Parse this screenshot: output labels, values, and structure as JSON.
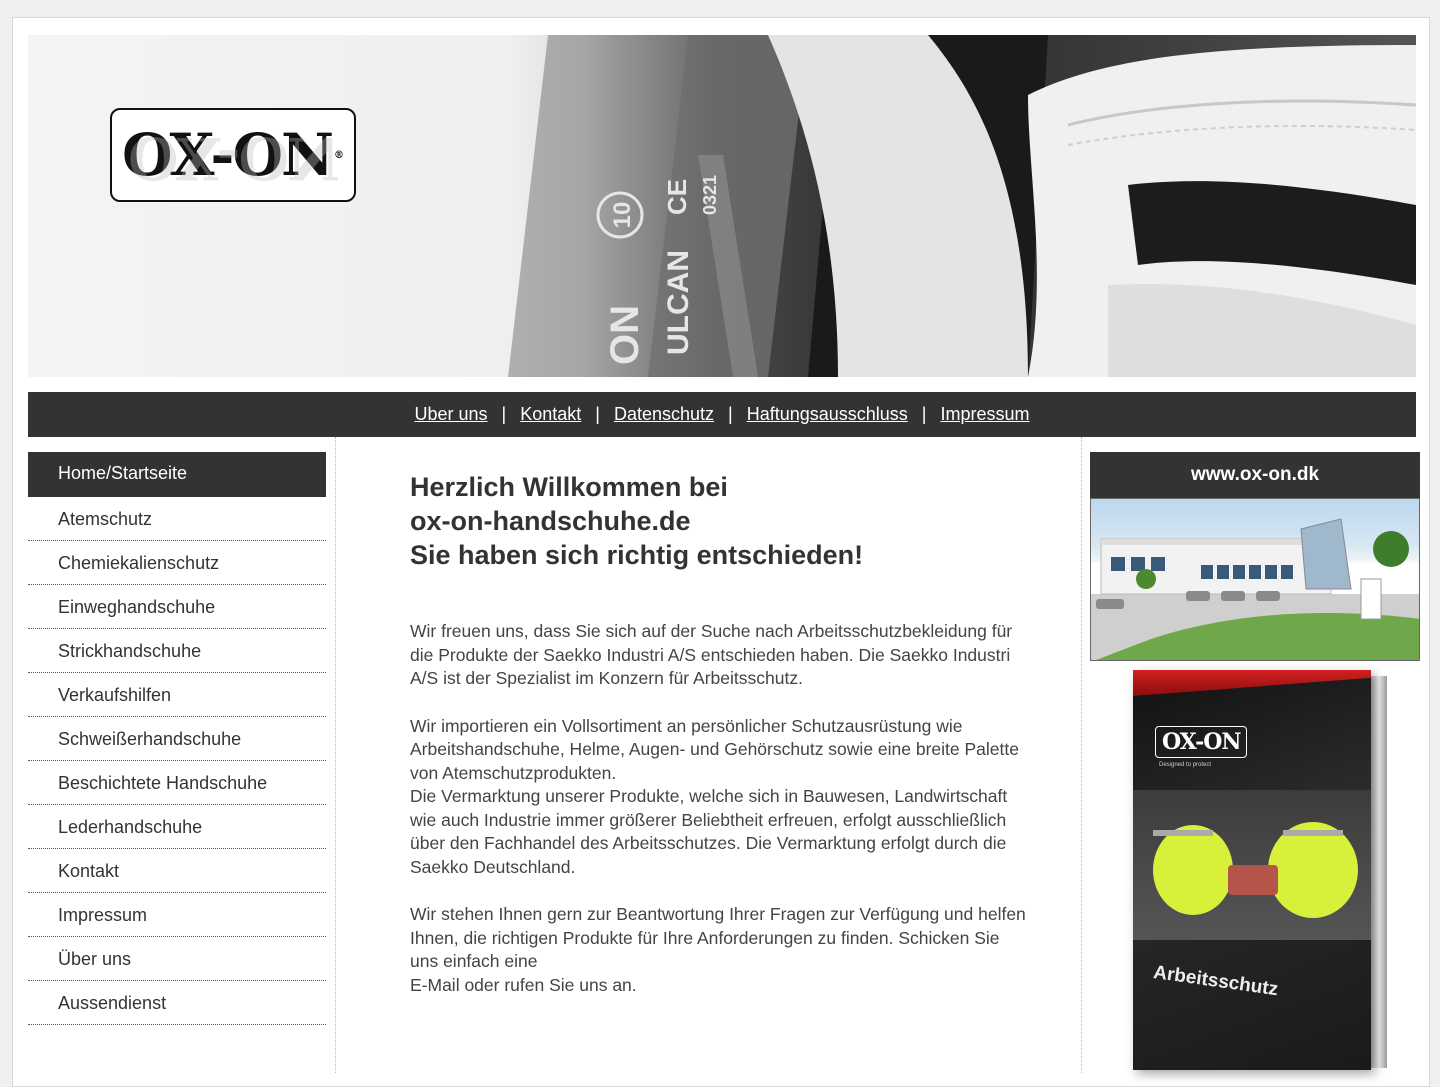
{
  "logo": {
    "text": "OX-ON",
    "reg": "®"
  },
  "topnav": {
    "links": [
      "Uber uns",
      "Kontakt",
      "Datenschutz",
      "Haftungsausschluss",
      "Impressum"
    ],
    "separator": "|"
  },
  "sidebar": {
    "items": [
      {
        "label": "Home/Startseite",
        "active": true
      },
      {
        "label": "Atemschutz"
      },
      {
        "label": "Chemiekalienschutz"
      },
      {
        "label": "Einweghandschuhe"
      },
      {
        "label": "Strickhandschuhe"
      },
      {
        "label": "Verkaufshilfen"
      },
      {
        "label": "Schweißerhandschuhe"
      },
      {
        "label": "Beschichtete Handschuhe"
      },
      {
        "label": "Lederhandschuhe"
      },
      {
        "label": "Kontakt"
      },
      {
        "label": "Impressum"
      },
      {
        "label": "Über uns"
      },
      {
        "label": "Aussendienst"
      }
    ]
  },
  "main": {
    "heading_lines": [
      "Herzlich Willkommen bei",
      "ox-on-handschuhe.de",
      "Sie haben sich richtig entschieden!"
    ],
    "paragraphs": [
      "Wir freuen uns, dass Sie sich auf der Suche nach Arbeitsschutzbekleidung für die Produkte der Saekko Industri A/S entschieden haben. Die Saekko Industri A/S ist der Spezialist im Konzern für Arbeitsschutz.",
      "Wir importieren ein Vollsortiment an persönlicher Schutzausrüstung wie Arbeitshandschuhe, Helme, Augen- und Gehörschutz sowie eine breite Palette von Atemschutzprodukten.",
      "Die Vermarktung unserer Produkte, welche sich in Bauwesen, Landwirtschaft wie auch Industrie immer größerer Beliebtheit erfreuen, erfolgt ausschließlich über den Fachhandel des Arbeitsschutzes. Die Vermarktung erfolgt durch die Saekko Deutschland.",
      "Wir stehen Ihnen gern zur Beantwortung Ihrer Fragen zur Verfügung und helfen Ihnen, die richtigen Produkte für Ihre Anforderungen zu finden. Schicken Sie uns einfach eine",
      "E-Mail oder rufen Sie uns an."
    ]
  },
  "right": {
    "link_label": "www.ox-on.dk",
    "book": {
      "logo": "OX-ON",
      "tagline": "Designed to protect",
      "title": "Arbeitsschutz"
    }
  },
  "glove_print": {
    "brand": "ON",
    "model": "ULCAN",
    "size": "10",
    "code": "0321",
    "ce": "CE"
  }
}
